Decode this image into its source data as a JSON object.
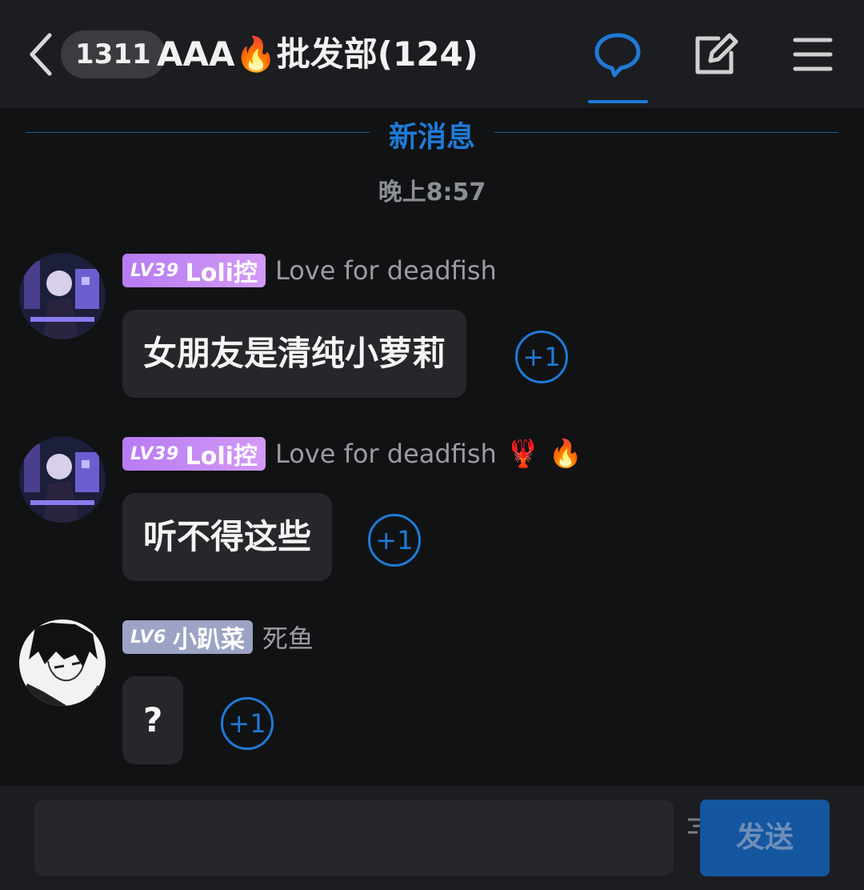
{
  "header": {
    "back_icon": "chevron-left-icon",
    "unread_count": "1311",
    "title": "AAA🔥批发部(124)",
    "icons": [
      "chat-bubble-icon",
      "edit-icon",
      "menu-icon"
    ],
    "accent_color": "#1f7ad8"
  },
  "chat": {
    "new_messages_label": "新消息",
    "timestamp": "晚上8:57",
    "messages": [
      {
        "level": "LV39",
        "tag": "Loli控",
        "nickname": "Love for deadfish",
        "emojis": "",
        "text": "女朋友是清纯小萝莉",
        "reaction": "+1"
      },
      {
        "level": "LV39",
        "tag": "Loli控",
        "nickname": "Love for deadfish",
        "emojis": "🦞 🔥",
        "text": "听不得这些",
        "reaction": "+1"
      },
      {
        "level": "LV6",
        "tag": "小趴菜",
        "nickname": "死鱼",
        "emojis": "",
        "text": "?",
        "reaction": "+1"
      }
    ]
  },
  "composer": {
    "input_value": "",
    "send_label": "发送"
  }
}
